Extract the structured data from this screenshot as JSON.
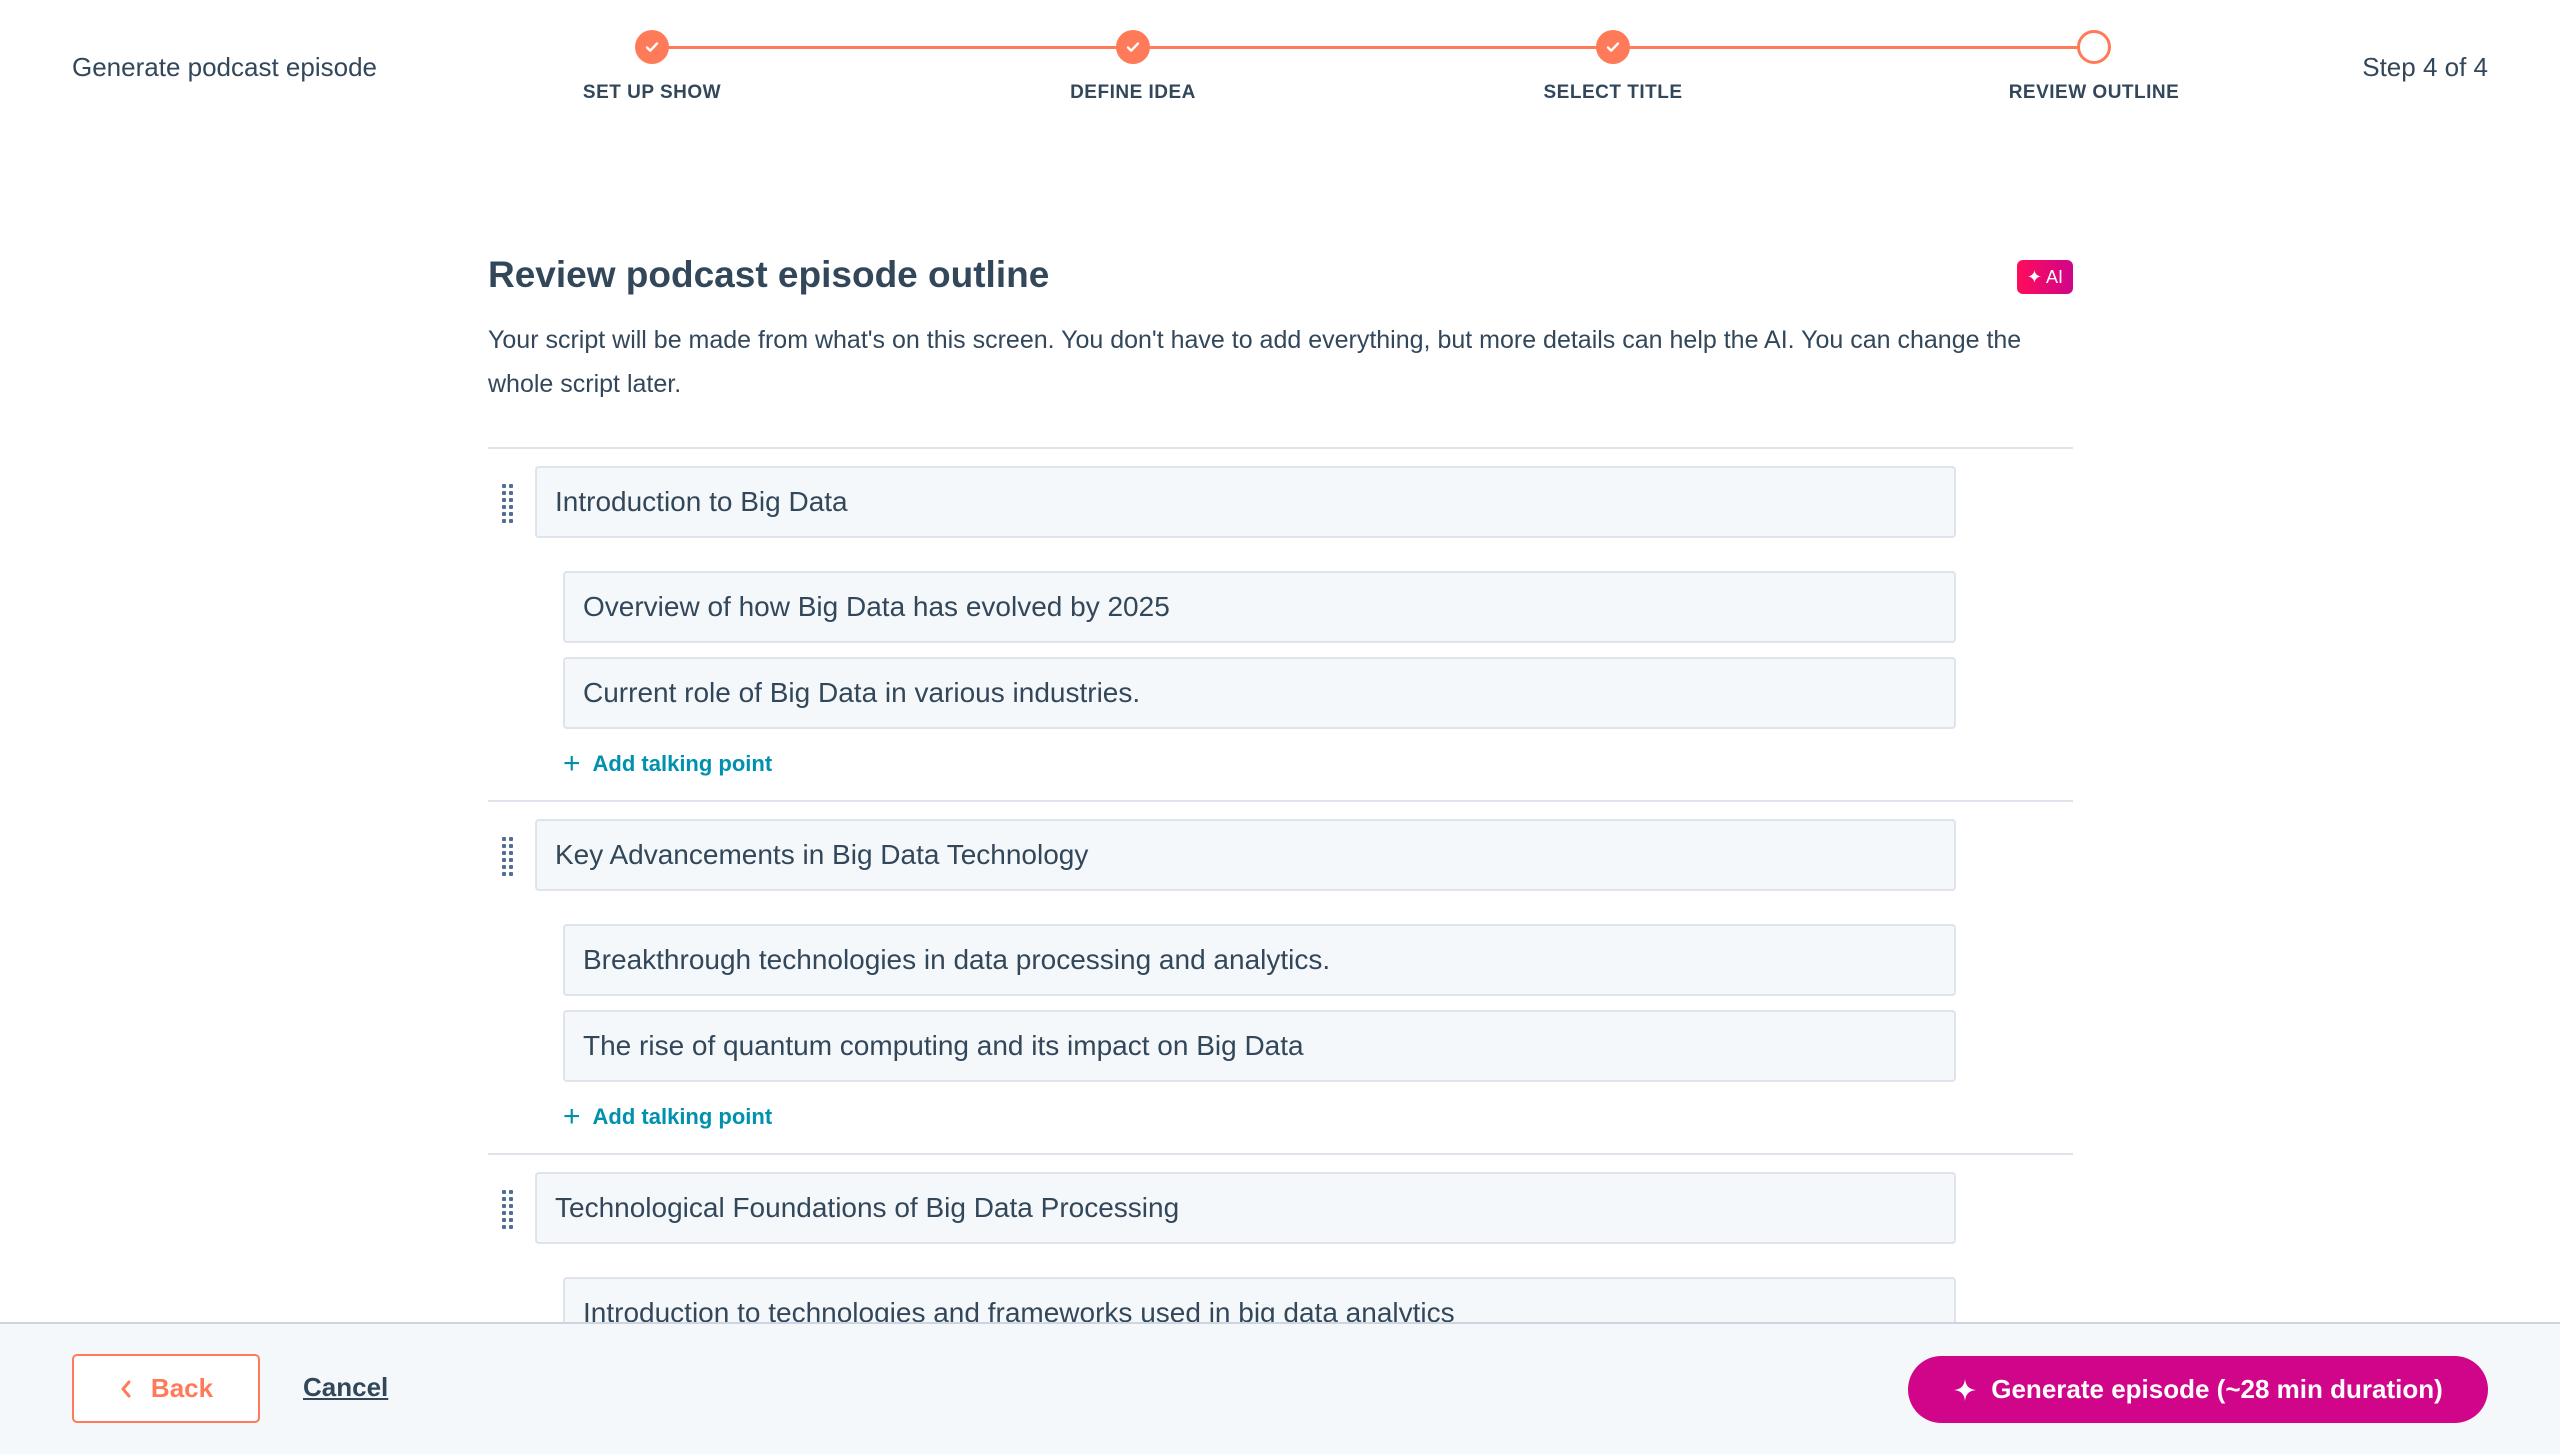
{
  "header": {
    "title": "Generate podcast episode",
    "step_counter": "Step 4 of 4"
  },
  "stepper": {
    "accent": "#ff7a59",
    "steps": [
      {
        "label": "SET UP SHOW",
        "status": "complete"
      },
      {
        "label": "DEFINE IDEA",
        "status": "complete"
      },
      {
        "label": "SELECT TITLE",
        "status": "complete"
      },
      {
        "label": "REVIEW OUTLINE",
        "status": "current"
      }
    ]
  },
  "main": {
    "heading": "Review podcast episode outline",
    "ai_badge": "AI",
    "description": "Your script will be made from what's on this screen. You don't have to add everything, but more details can help the AI. You can change the whole script later."
  },
  "outline": {
    "add_label": "Add talking point",
    "sections": [
      {
        "title": "Introduction to Big Data",
        "points": [
          "Overview of how Big Data has evolved by 2025",
          "Current role of Big Data in various industries."
        ]
      },
      {
        "title": "Key Advancements in Big Data Technology",
        "points": [
          "Breakthrough technologies in data processing and analytics.",
          "The rise of quantum computing and its impact on Big Data"
        ]
      },
      {
        "title": "Technological Foundations of Big Data Processing",
        "points": [
          "Introduction to technologies and frameworks used in big data analytics"
        ]
      }
    ]
  },
  "footer": {
    "back_label": "Back",
    "cancel_label": "Cancel",
    "generate_label": "Generate episode (~28 min duration)",
    "generate_color": "#d0058a"
  }
}
